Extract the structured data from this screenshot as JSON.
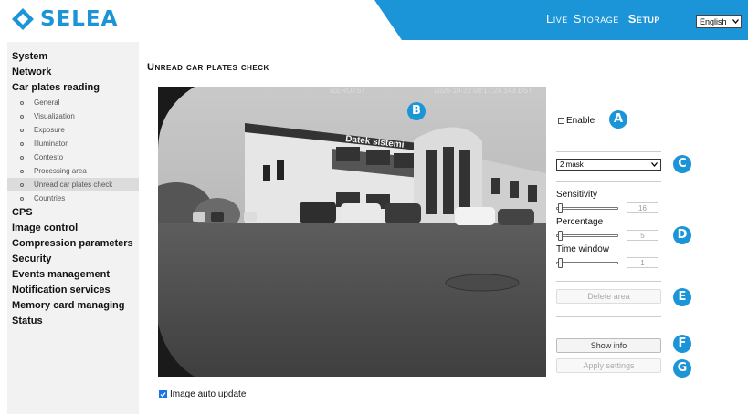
{
  "header": {
    "brand": "SELEA",
    "nav": [
      {
        "label": "Live",
        "active": false
      },
      {
        "label": "Storage",
        "active": false
      },
      {
        "label": "Setup",
        "active": true
      }
    ],
    "language": "English",
    "brand_color": "#1c95d8"
  },
  "sidebar": {
    "items": [
      {
        "label": "System",
        "level": 0
      },
      {
        "label": "Network",
        "level": 0
      },
      {
        "label": "Car plates reading",
        "level": 0
      },
      {
        "label": "General",
        "level": 1
      },
      {
        "label": "Visualization",
        "level": 1
      },
      {
        "label": "Exposure",
        "level": 1
      },
      {
        "label": "Illuminator",
        "level": 1
      },
      {
        "label": "Contesto",
        "level": 1
      },
      {
        "label": "Processing area",
        "level": 1
      },
      {
        "label": "Unread car plates check",
        "level": 1,
        "active": true
      },
      {
        "label": "Countries",
        "level": 1
      },
      {
        "label": "CPS",
        "level": 0
      },
      {
        "label": "Image control",
        "level": 0
      },
      {
        "label": "Compression parameters",
        "level": 0
      },
      {
        "label": "Security",
        "level": 0
      },
      {
        "label": "Events management",
        "level": 0
      },
      {
        "label": "Notification services",
        "level": 0
      },
      {
        "label": "Memory card managing",
        "level": 0
      },
      {
        "label": "Status",
        "level": 0
      }
    ]
  },
  "main": {
    "title": "Unread car plates check",
    "camera": {
      "name": "IZEROTST",
      "timestamp": "2020-10-22 08:17:24.143 DST",
      "sign_text": "Datek sistemi"
    },
    "auto_update_label": "Image auto update",
    "auto_update_checked": true
  },
  "panel": {
    "enable_label": "Enable",
    "enable_checked": false,
    "mask_value": "2 mask",
    "sensitivity": {
      "label": "Sensitivity",
      "value": "16"
    },
    "percentage": {
      "label": "Percentage",
      "value": "5"
    },
    "time_window": {
      "label": "Time window",
      "value": "1"
    },
    "delete_area": "Delete area",
    "show_info": "Show info",
    "apply_settings": "Apply settings"
  },
  "markers": [
    "A",
    "B",
    "C",
    "D",
    "E",
    "F",
    "G"
  ]
}
